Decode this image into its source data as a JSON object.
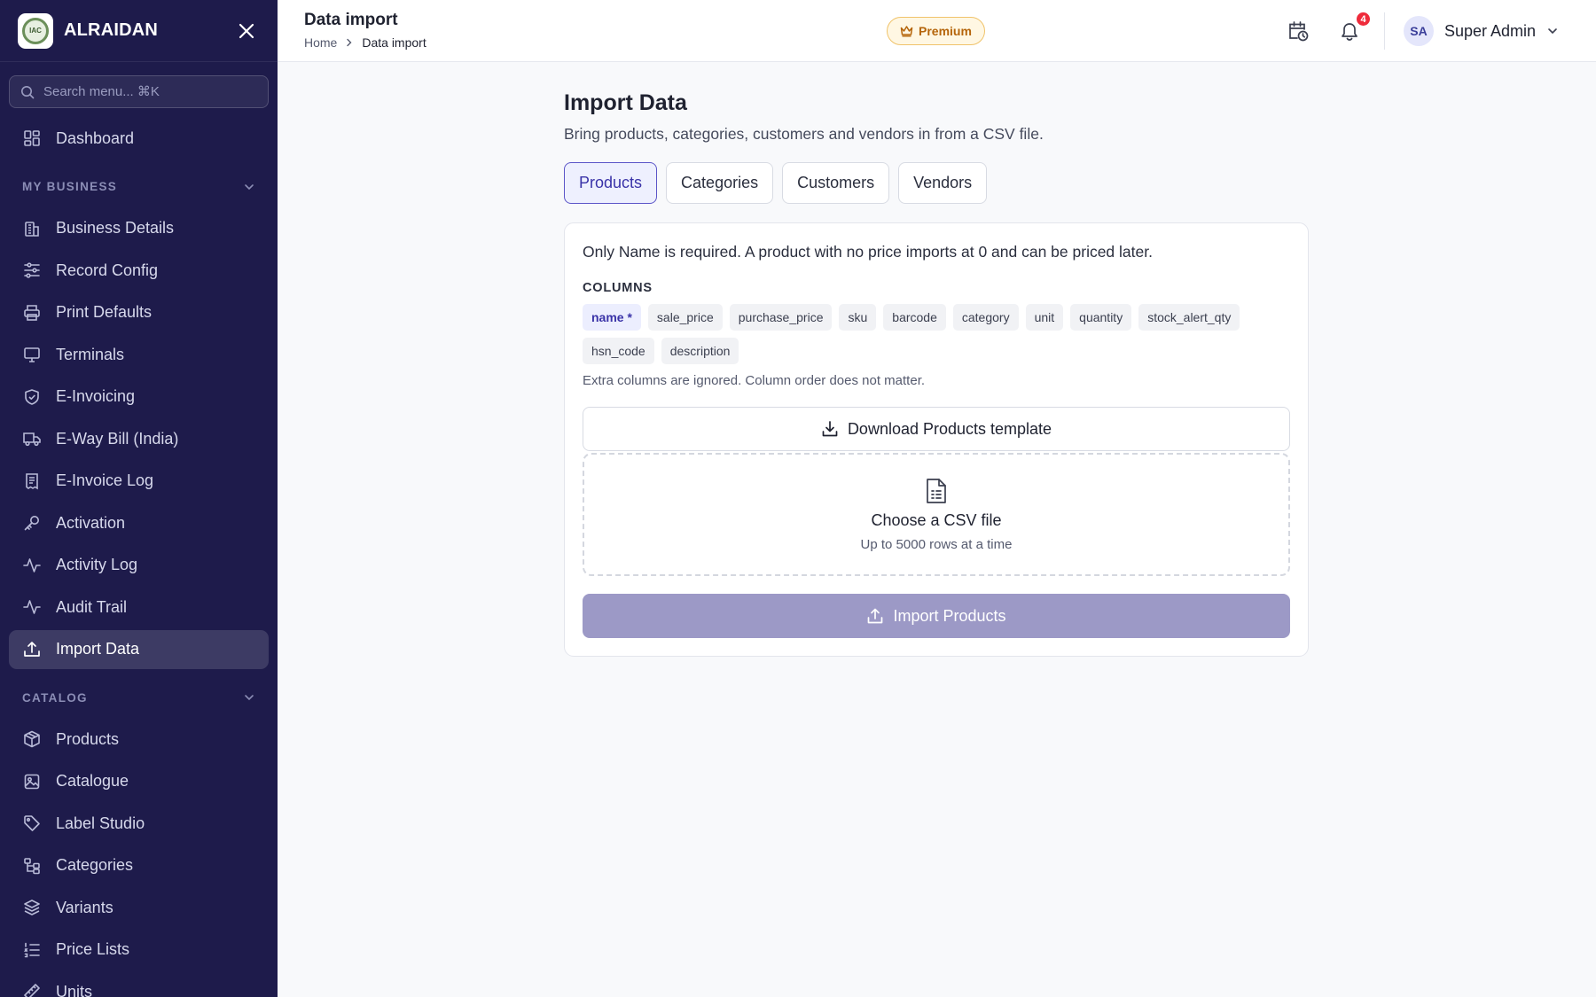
{
  "brand": {
    "name": "ALRAIDAN",
    "logo_text": "IAC"
  },
  "sidebar": {
    "search_placeholder": "Search menu... ⌘K",
    "dashboard": {
      "label": "Dashboard",
      "icon": "dashboard-icon"
    },
    "sections": [
      {
        "title": "MY BUSINESS"
      },
      {
        "title": "CATALOG"
      }
    ],
    "my_business": [
      {
        "label": "Business Details",
        "icon": "building-icon"
      },
      {
        "label": "Record Config",
        "icon": "sliders-icon"
      },
      {
        "label": "Print Defaults",
        "icon": "printer-icon"
      },
      {
        "label": "Terminals",
        "icon": "monitor-icon"
      },
      {
        "label": "E-Invoicing",
        "icon": "shield-check-icon"
      },
      {
        "label": "E-Way Bill (India)",
        "icon": "truck-icon"
      },
      {
        "label": "E-Invoice Log",
        "icon": "receipt-icon"
      },
      {
        "label": "Activation",
        "icon": "key-icon"
      },
      {
        "label": "Activity Log",
        "icon": "activity-icon"
      },
      {
        "label": "Audit Trail",
        "icon": "activity-icon"
      },
      {
        "label": "Import Data",
        "icon": "upload-icon",
        "active": true
      }
    ],
    "catalog": [
      {
        "label": "Products",
        "icon": "package-icon"
      },
      {
        "label": "Catalogue",
        "icon": "image-icon"
      },
      {
        "label": "Label Studio",
        "icon": "tag-icon"
      },
      {
        "label": "Categories",
        "icon": "tree-icon"
      },
      {
        "label": "Variants",
        "icon": "layers-icon"
      },
      {
        "label": "Price Lists",
        "icon": "list-ordered-icon"
      },
      {
        "label": "Units",
        "icon": "ruler-icon"
      }
    ]
  },
  "header": {
    "title": "Data import",
    "breadcrumb": [
      "Home",
      "Data import"
    ],
    "premium_label": "Premium",
    "notification_count": "4",
    "user": {
      "initials": "SA",
      "name": "Super Admin"
    }
  },
  "main": {
    "title": "Import Data",
    "subtitle": "Bring products, categories, customers and vendors in from a CSV file.",
    "tabs": [
      "Products",
      "Categories",
      "Customers",
      "Vendors"
    ],
    "active_tab": 0,
    "note": "Only Name is required. A product with no price imports at 0 and can be priced later.",
    "columns_title": "COLUMNS",
    "columns": [
      "name *",
      "sale_price",
      "purchase_price",
      "sku",
      "barcode",
      "category",
      "unit",
      "quantity",
      "stock_alert_qty",
      "hsn_code",
      "description"
    ],
    "extra_note": "Extra columns are ignored. Column order does not matter.",
    "download_label": "Download Products template",
    "drop_title": "Choose a CSV file",
    "drop_sub": "Up to 5000 rows at a time",
    "import_label": "Import Products"
  },
  "colors": {
    "sidebar_bg": "#1e1b4b",
    "accent": "#5b55c8",
    "import_disabled": "#9c99c6",
    "badge": "#ef2b3b",
    "premium": "#b5650b"
  }
}
